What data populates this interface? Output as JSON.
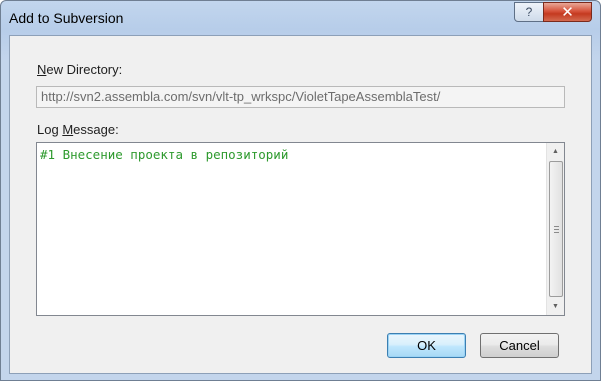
{
  "window": {
    "title": "Add to Subversion",
    "help_glyph": "?",
    "close_glyph": "✕"
  },
  "new_directory": {
    "label_mnemonic": "N",
    "label_rest": "ew Directory:",
    "value": "http://svn2.assembla.com/svn/vlt-tp_wrkspc/VioletTapeAssemblaTest/"
  },
  "log_message": {
    "label_prefix": "Log ",
    "label_mnemonic": "M",
    "label_rest": "essage:",
    "text": "#1 Внесение проекта в репозиторий"
  },
  "buttons": {
    "ok_label": "OK",
    "cancel_label": "Cancel"
  },
  "icons": {
    "scroll_up": "▲",
    "scroll_down": "▼"
  },
  "colors": {
    "log_text": "#2e9a2e",
    "ok_border": "#3c7fb1",
    "close_red": "#c43a20"
  }
}
